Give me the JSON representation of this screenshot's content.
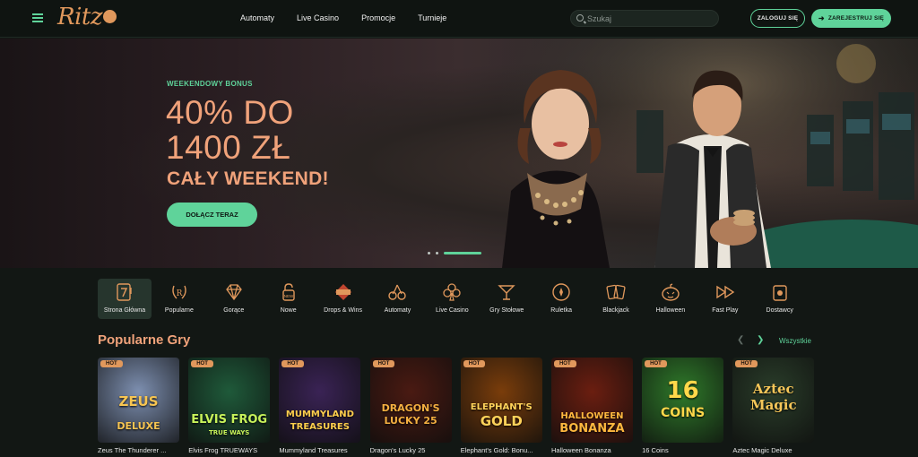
{
  "header": {
    "logo": "Ritz",
    "nav": [
      "Automaty",
      "Live Casino",
      "Promocje",
      "Turnieje"
    ],
    "search_placeholder": "Szukaj",
    "login_label": "ZALOGUJ SIĘ",
    "register_label": "ZAREJESTRUJ SIĘ",
    "accent_color": "#5fd39a"
  },
  "hero": {
    "promo_label": "WEEKENDOWY BONUS",
    "headline_line1": "40% DO",
    "headline_line2": "1400 ZŁ",
    "headline_line3": "CAŁY WEEKEND!",
    "cta_label": "DOŁĄCZ TERAZ",
    "slides": 3,
    "active_slide": 3
  },
  "categories": [
    {
      "label": "Strona Główna",
      "icon": "slot-seven-icon",
      "active": true
    },
    {
      "label": "Popularne",
      "icon": "laurel-icon"
    },
    {
      "label": "Gorące",
      "icon": "diamond-icon"
    },
    {
      "label": "Nowe",
      "icon": "lock-new-icon"
    },
    {
      "label": "Drops & Wins",
      "icon": "drops-wins-icon"
    },
    {
      "label": "Automaty",
      "icon": "cherries-icon"
    },
    {
      "label": "Live Casino",
      "icon": "club-icon"
    },
    {
      "label": "Gry Stołowe",
      "icon": "cocktail-icon"
    },
    {
      "label": "Ruletka",
      "icon": "roulette-icon"
    },
    {
      "label": "Blackjack",
      "icon": "cards-icon"
    },
    {
      "label": "Halloween",
      "icon": "pumpkin-icon"
    },
    {
      "label": "Fast Play",
      "icon": "fast-forward-icon"
    },
    {
      "label": "Dostawcy",
      "icon": "provider-icon"
    }
  ],
  "popular": {
    "title": "Popularne Gry",
    "see_all": "Wszystkie",
    "hot_badge": "HOT",
    "games": [
      {
        "title": "Zeus The Thunderer ...",
        "logo": "ZEUS",
        "logo2": "DELUXE",
        "bg": "#7d8fb0",
        "fg": "#f7c552"
      },
      {
        "title": "Elvis Frog TRUEWAYS",
        "logo": "ELVIS FROG",
        "logo2": "TRUE WAYS",
        "bg": "#1f5a3a",
        "fg": "#c7f25a"
      },
      {
        "title": "Mummyland Treasures",
        "logo": "MUMMYLAND",
        "logo2": "TREASURES",
        "bg": "#3a2355",
        "fg": "#ffcf4d"
      },
      {
        "title": "Dragon's Lucky 25",
        "logo": "DRAGON'S",
        "logo2": "LUCKY 25",
        "bg": "#4a1a12",
        "fg": "#f5b041"
      },
      {
        "title": "Elephant's Gold: Bonu...",
        "logo": "ELEPHANT'S",
        "logo2": "GOLD",
        "bg": "#7a3d0b",
        "fg": "#ffd35a"
      },
      {
        "title": "Halloween Bonanza",
        "logo": "HALLOWEEN",
        "logo2": "BONANZA",
        "bg": "#6b1e10",
        "fg": "#ffb83f"
      },
      {
        "title": "16 Coins",
        "logo": "16",
        "logo2": "COINS",
        "bg": "#2f7a2a",
        "fg": "#ffd84a"
      },
      {
        "title": "Aztec Magic Deluxe",
        "logo": "Aztec",
        "logo2": "Magic",
        "bg": "#2a3d2a",
        "fg": "#f5c659"
      }
    ]
  }
}
